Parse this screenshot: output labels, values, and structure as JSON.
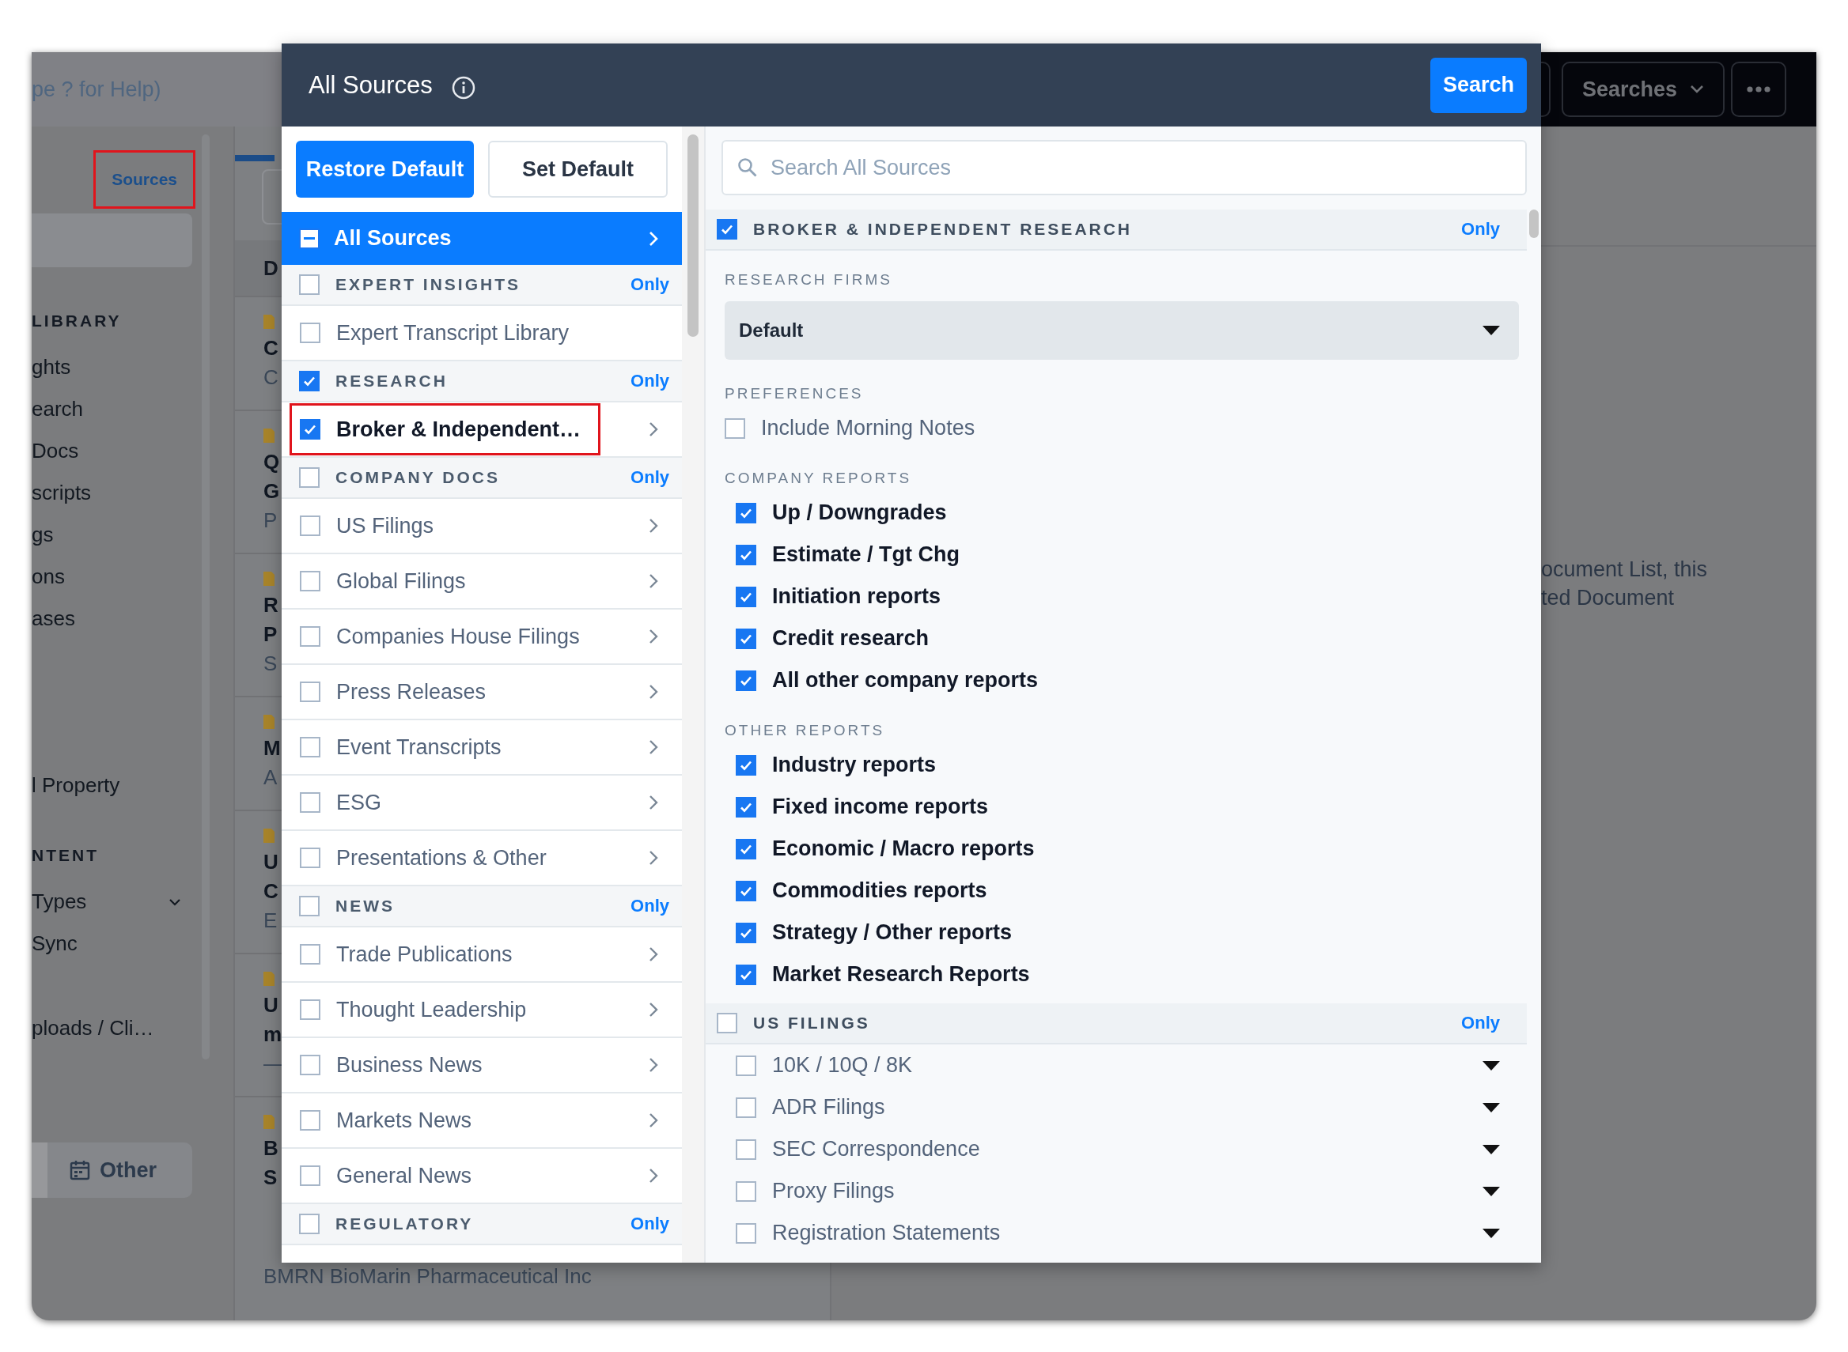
{
  "background": {
    "search_hint": "pe ? for Help)",
    "searches_button": "Searches",
    "sidebar": {
      "sources_tab": {
        "label": "Sources",
        "highlighted": true
      },
      "groups": [
        {
          "heading": "LIBRARY",
          "items": [
            {
              "kind": "link",
              "label": "ghts"
            },
            {
              "kind": "link",
              "label": "earch"
            },
            {
              "kind": "link",
              "label": "Docs"
            },
            {
              "kind": "link",
              "label": "scripts"
            },
            {
              "kind": "link",
              "label": "gs"
            },
            {
              "kind": "link",
              "label": "ons"
            },
            {
              "kind": "link",
              "label": "ases"
            },
            {
              "kind": "link",
              "label": "l Property"
            }
          ]
        },
        {
          "heading": "NTENT",
          "items": [
            {
              "kind": "expander",
              "label": "Types"
            },
            {
              "kind": "link",
              "label": "Sync"
            },
            {
              "kind": "link",
              "label": "ploads / Cli…"
            }
          ]
        }
      ],
      "other_button": "Other"
    },
    "documents": {
      "header": "D",
      "rows": [
        {
          "titles": [
            "C"
          ],
          "subtitle": "C"
        },
        {
          "titles": [
            "Q",
            "G"
          ],
          "subtitle": "P"
        },
        {
          "titles": [
            "R",
            "P"
          ],
          "subtitle": "S"
        },
        {
          "titles": [
            "M"
          ],
          "subtitle": "A"
        },
        {
          "titles": [
            "U",
            "C"
          ],
          "subtitle": "E"
        },
        {
          "titles": [
            "U",
            "m"
          ],
          "subtitle": "—"
        },
        {
          "titles": [
            "B",
            "S"
          ],
          "subtitle": "BMRN BioMarin Pharmaceutical Inc"
        }
      ]
    },
    "detail_lines": [
      "ocument List, this",
      "ted Document"
    ]
  },
  "modal": {
    "title": "All Sources",
    "search_button": "Search",
    "restore_button": "Restore Default",
    "set_default_button": "Set Default",
    "all_sources": {
      "label": "All Sources",
      "indeterminate": true
    },
    "categories": [
      {
        "kind": "section",
        "label": "EXPERT INSIGHTS",
        "checked": false,
        "only": "Only"
      },
      {
        "kind": "item",
        "label": "Expert Transcript Library",
        "checked": false,
        "arrow": false,
        "highlighted": false
      },
      {
        "kind": "section",
        "label": "RESEARCH",
        "checked": true,
        "only": "Only"
      },
      {
        "kind": "item",
        "label": "Broker & Independent…",
        "checked": true,
        "arrow": true,
        "highlighted": true
      },
      {
        "kind": "section",
        "label": "COMPANY DOCS",
        "checked": false,
        "only": "Only"
      },
      {
        "kind": "item",
        "label": "US Filings",
        "checked": false,
        "arrow": true,
        "highlighted": false
      },
      {
        "kind": "item",
        "label": "Global Filings",
        "checked": false,
        "arrow": true,
        "highlighted": false
      },
      {
        "kind": "item",
        "label": "Companies House Filings",
        "checked": false,
        "arrow": true,
        "highlighted": false
      },
      {
        "kind": "item",
        "label": "Press Releases",
        "checked": false,
        "arrow": true,
        "highlighted": false
      },
      {
        "kind": "item",
        "label": "Event Transcripts",
        "checked": false,
        "arrow": true,
        "highlighted": false
      },
      {
        "kind": "item",
        "label": "ESG",
        "checked": false,
        "arrow": true,
        "highlighted": false
      },
      {
        "kind": "item",
        "label": "Presentations & Other",
        "checked": false,
        "arrow": true,
        "highlighted": false
      },
      {
        "kind": "section",
        "label": "NEWS",
        "checked": false,
        "only": "Only"
      },
      {
        "kind": "item",
        "label": "Trade Publications",
        "checked": false,
        "arrow": true,
        "highlighted": false
      },
      {
        "kind": "item",
        "label": "Thought Leadership",
        "checked": false,
        "arrow": true,
        "highlighted": false
      },
      {
        "kind": "item",
        "label": "Business News",
        "checked": false,
        "arrow": true,
        "highlighted": false
      },
      {
        "kind": "item",
        "label": "Markets News",
        "checked": false,
        "arrow": true,
        "highlighted": false
      },
      {
        "kind": "item",
        "label": "General News",
        "checked": false,
        "arrow": true,
        "highlighted": false
      },
      {
        "kind": "section",
        "label": "REGULATORY",
        "checked": false,
        "only": "Only"
      }
    ],
    "search_placeholder": "Search All Sources",
    "detail": {
      "title": "BROKER & INDEPENDENT RESEARCH",
      "checked": true,
      "only": "Only",
      "entries": [
        {
          "kind": "label",
          "text": "RESEARCH FIRMS"
        },
        {
          "kind": "dropdown",
          "value": "Default"
        },
        {
          "kind": "label",
          "text": "PREFERENCES"
        },
        {
          "kind": "option",
          "label": "Include Morning Notes",
          "checked": false
        },
        {
          "kind": "label",
          "text": "COMPANY REPORTS"
        },
        {
          "kind": "report",
          "label": "Up / Downgrades",
          "checked": true
        },
        {
          "kind": "report",
          "label": "Estimate / Tgt Chg",
          "checked": true
        },
        {
          "kind": "report",
          "label": "Initiation reports",
          "checked": true
        },
        {
          "kind": "report",
          "label": "Credit research",
          "checked": true
        },
        {
          "kind": "report",
          "label": "All other company reports",
          "checked": true
        },
        {
          "kind": "label",
          "text": "OTHER REPORTS"
        },
        {
          "kind": "report",
          "label": "Industry reports",
          "checked": true
        },
        {
          "kind": "report",
          "label": "Fixed income reports",
          "checked": true
        },
        {
          "kind": "report",
          "label": "Economic / Macro reports",
          "checked": true
        },
        {
          "kind": "report",
          "label": "Commodities reports",
          "checked": true
        },
        {
          "kind": "report",
          "label": "Strategy / Other reports",
          "checked": true
        },
        {
          "kind": "report",
          "label": "Market Research Reports",
          "checked": true
        }
      ]
    },
    "us_filings": {
      "title": "US FILINGS",
      "checked": false,
      "only": "Only",
      "items": [
        {
          "label": "10K / 10Q / 8K",
          "checked": false
        },
        {
          "label": "ADR Filings",
          "checked": false
        },
        {
          "label": "SEC Correspondence",
          "checked": false
        },
        {
          "label": "Proxy Filings",
          "checked": false
        },
        {
          "label": "Registration Statements",
          "checked": false
        }
      ]
    }
  }
}
